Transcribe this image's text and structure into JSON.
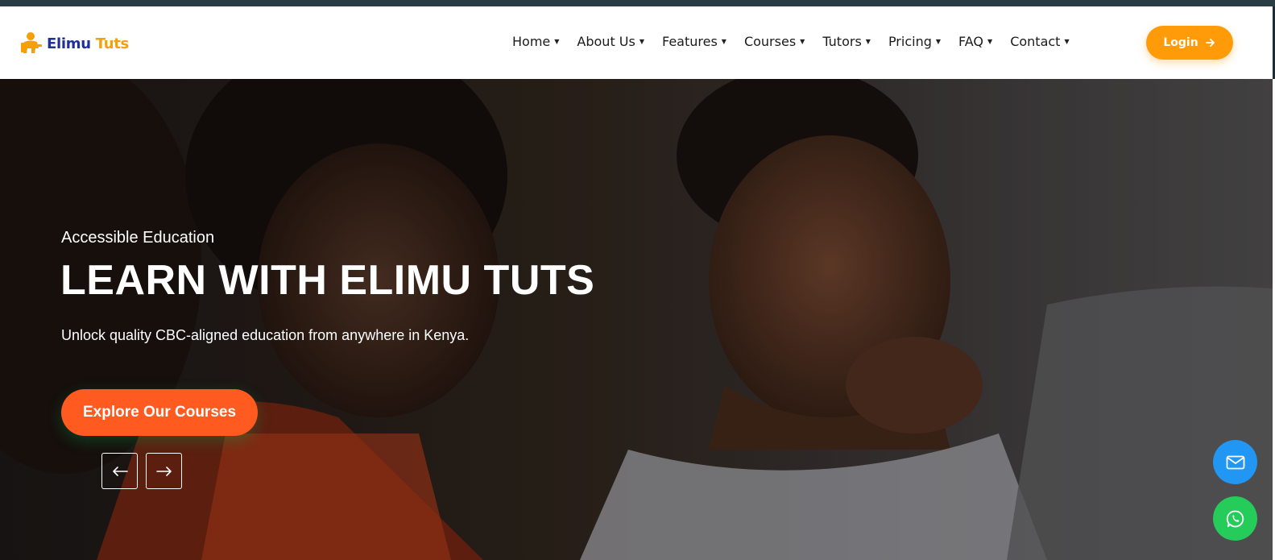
{
  "brand": {
    "name_part1": "Elimu",
    "name_part2": "Tuts",
    "colors": {
      "blue": "#1f2f9e",
      "orange": "#f5a00a"
    }
  },
  "nav": {
    "items": [
      {
        "label": "Home"
      },
      {
        "label": "About Us"
      },
      {
        "label": "Features"
      },
      {
        "label": "Courses"
      },
      {
        "label": "Tutors"
      },
      {
        "label": "Pricing"
      },
      {
        "label": "FAQ"
      },
      {
        "label": "Contact"
      }
    ],
    "caret_icon": "caret-down-icon",
    "login_label": "Login",
    "login_icon": "arrow-right-icon",
    "login_color": "#ff9a08"
  },
  "hero": {
    "eyebrow": "Accessible Education",
    "title": "LEARN WITH ELIMU TUTS",
    "description": "Unlock quality CBC-aligned education from anywhere in Kenya.",
    "cta_label": "Explore Our Courses",
    "cta_color": "#ff5a1f",
    "prev_icon": "arrow-left-icon",
    "next_icon": "arrow-right-icon"
  },
  "floating": {
    "email_icon": "mail-icon",
    "email_color": "#2196f3",
    "whatsapp_icon": "whatsapp-icon",
    "whatsapp_color": "#25cc5a"
  }
}
